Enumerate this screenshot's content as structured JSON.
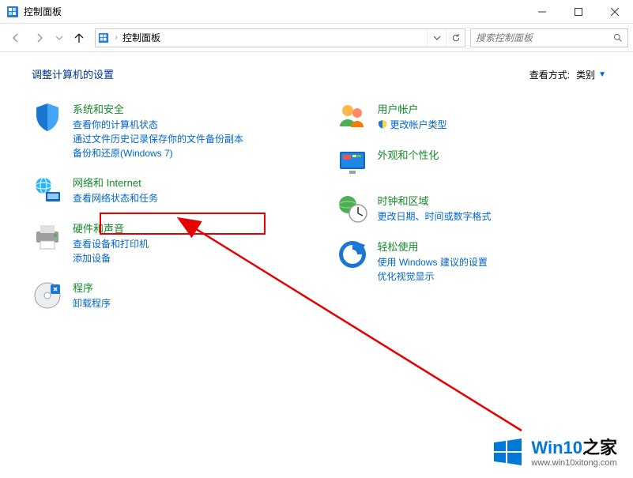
{
  "window": {
    "title": "控制面板"
  },
  "nav": {
    "breadcrumb": "控制面板",
    "search_placeholder": "搜索控制面板"
  },
  "header": {
    "page_title": "调整计算机的设置",
    "view_label": "查看方式:",
    "view_value": "类别"
  },
  "left_categories": [
    {
      "title": "系统和安全",
      "links": [
        "查看你的计算机状态",
        "通过文件历史记录保存你的文件备份副本",
        "备份和还原(Windows 7)"
      ]
    },
    {
      "title": "网络和 Internet",
      "links": [
        "查看网络状态和任务"
      ]
    },
    {
      "title": "硬件和声音",
      "links": [
        "查看设备和打印机",
        "添加设备"
      ]
    },
    {
      "title": "程序",
      "links": [
        "卸载程序"
      ]
    }
  ],
  "right_categories": [
    {
      "title": "用户帐户",
      "links": [
        "更改帐户类型"
      ]
    },
    {
      "title": "外观和个性化",
      "links": []
    },
    {
      "title": "时钟和区域",
      "links": [
        "更改日期、时间或数字格式"
      ]
    },
    {
      "title": "轻松使用",
      "links": [
        "使用 Windows 建议的设置",
        "优化视觉显示"
      ]
    }
  ],
  "watermark": {
    "brand_prefix": "Win10",
    "brand_suffix": "之家",
    "url": "www.win10xitong.com"
  }
}
